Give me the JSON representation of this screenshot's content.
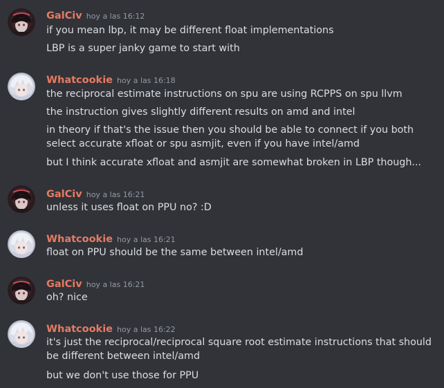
{
  "messages": [
    {
      "user": "GalCiv",
      "avatar_icon": "user-avatar-dark",
      "time": "hoy a las 16:12",
      "lines": [
        "if you mean lbp, it may be different float implementations",
        "LBP is a super janky game to start with"
      ]
    },
    {
      "user": "Whatcookie",
      "avatar_icon": "user-avatar-light",
      "time": "hoy a las 16:18",
      "lines": [
        "the reciprocal estimate instructions on spu are using RCPPS on spu llvm",
        "the instruction gives slightly different results on amd and intel",
        "in theory if that's the issue then you should be able to connect if you both select accurate xfloat or spu asmjit, even if you have intel/amd",
        "but I think accurate xfloat and asmjit are somewhat broken in LBP though..."
      ]
    },
    {
      "user": "GalCiv",
      "avatar_icon": "user-avatar-dark",
      "time": "hoy a las 16:21",
      "lines": [
        "unless it uses float on PPU no? :D"
      ]
    },
    {
      "user": "Whatcookie",
      "avatar_icon": "user-avatar-light",
      "time": "hoy a las 16:21",
      "lines": [
        "float on PPU should be the same between intel/amd"
      ]
    },
    {
      "user": "GalCiv",
      "avatar_icon": "user-avatar-dark",
      "time": "hoy a las 16:21",
      "lines": [
        "oh? nice"
      ]
    },
    {
      "user": "Whatcookie",
      "avatar_icon": "user-avatar-light",
      "time": "hoy a las 16:22",
      "lines": [
        "it's just the reciprocal/reciprocal square root estimate instructions that should be different between intel/amd",
        "but we don't use those for PPU"
      ]
    }
  ],
  "colors": {
    "background": "#313338",
    "username": "#e67b63",
    "timestamp": "#949ba4",
    "text": "#dbdee1"
  }
}
